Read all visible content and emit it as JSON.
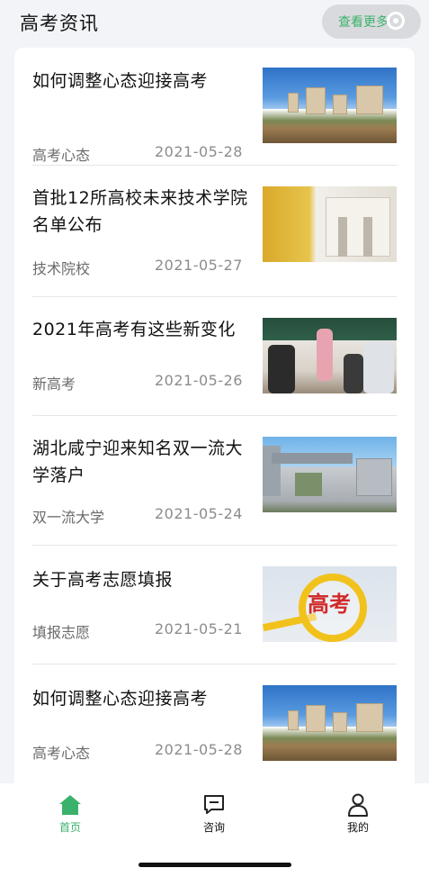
{
  "header": {
    "title": "高考资讯",
    "more_label": "查看更多",
    "more_icon": "refresh-circle-icon"
  },
  "news": [
    {
      "title": "如何调整心态迎接高考",
      "tag": "高考心态",
      "date": "2021-05-28",
      "image": "campus-buildings"
    },
    {
      "title": "首批12所高校未来技术学院名单公布",
      "tag": "技术院校",
      "date": "2021-05-27",
      "image": "university-gate-ginkgo"
    },
    {
      "title": "2021年高考有这些新变化",
      "tag": "新高考",
      "date": "2021-05-26",
      "image": "classroom"
    },
    {
      "title": "湖北咸宁迎来知名双一流大学落户",
      "tag": "双一流大学",
      "date": "2021-05-24",
      "image": "university-gate"
    },
    {
      "title": "关于高考志愿填报",
      "tag": "填报志愿",
      "date": "2021-05-21",
      "image": "magnifier-gaokao",
      "image_text": "高考"
    },
    {
      "title": "如何调整心态迎接高考",
      "tag": "高考心态",
      "date": "2021-05-28",
      "image": "campus-buildings"
    }
  ],
  "tabbar": {
    "items": [
      {
        "label": "首页",
        "icon": "home-icon",
        "active": true
      },
      {
        "label": "咨询",
        "icon": "chat-icon",
        "active": false
      },
      {
        "label": "我的",
        "icon": "user-icon",
        "active": false
      }
    ]
  },
  "colors": {
    "accent": "#3bb26b",
    "background": "#f3f4f8"
  }
}
